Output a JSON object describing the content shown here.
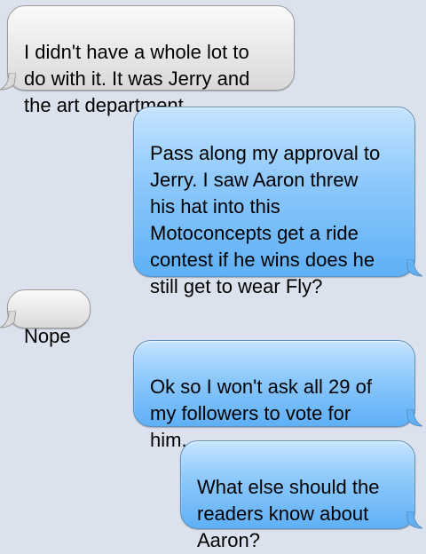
{
  "messages": [
    {
      "direction": "incoming",
      "text": "I didn't have a whole lot to\ndo with it.  It was Jerry and\nthe art department"
    },
    {
      "direction": "outgoing",
      "text": "Pass along my approval to\nJerry. I saw Aaron threw\nhis hat into this\nMotoconcepts get a ride\ncontest if he wins does he\nstill get to wear Fly?"
    },
    {
      "direction": "incoming",
      "text": "Nope"
    },
    {
      "direction": "outgoing",
      "text": "Ok so I won't ask all 29 of\nmy followers to vote for\nhim."
    },
    {
      "direction": "outgoing",
      "text": "What else should the\nreaders know about\nAaron?"
    }
  ],
  "colors": {
    "background": "#dbe2ed",
    "incoming_bubble": "#e8e8e8",
    "outgoing_bubble": "#8cc8fb"
  }
}
